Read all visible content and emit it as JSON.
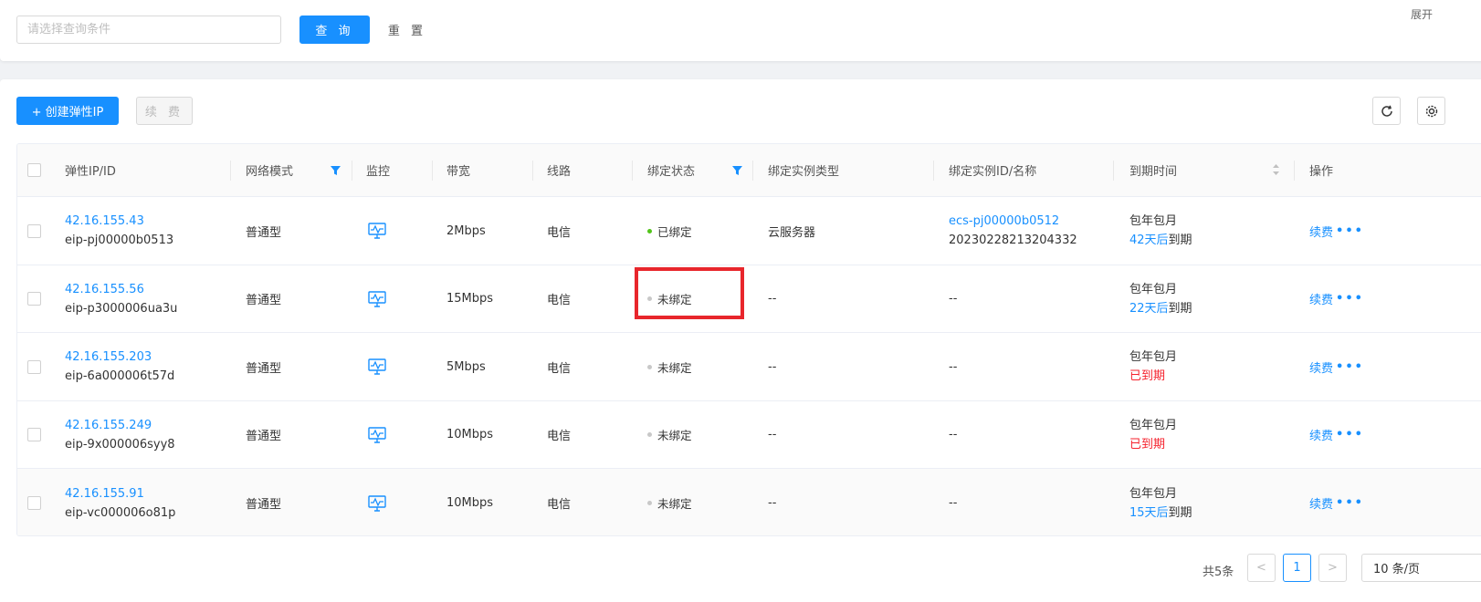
{
  "search": {
    "placeholder": "请选择查询条件",
    "query_label": "查 询",
    "reset_label": "重 置",
    "expand_label": "展开"
  },
  "toolbar": {
    "create_label": "+ 创建弹性IP",
    "renew_label": "续 费"
  },
  "table": {
    "headers": {
      "ip": "弹性IP/ID",
      "mode": "网络模式",
      "monitor": "监控",
      "bandwidth": "带宽",
      "line": "线路",
      "bind_status": "绑定状态",
      "instance_type": "绑定实例类型",
      "instance_id": "绑定实例ID/名称",
      "expire": "到期时间",
      "action": "操作"
    },
    "rows": [
      {
        "ip": "42.16.155.43",
        "id": "eip-pj00000b0513",
        "mode": "普通型",
        "bandwidth": "2Mbps",
        "line": "电信",
        "bind_status": "已绑定",
        "instance_type": "云服务器",
        "instance_id": "ecs-pj00000b0512",
        "instance_name": "20230228213204332",
        "billing": "包年包月",
        "expire_prefix": "42天后",
        "expire_suffix": "到期",
        "action": "续费"
      },
      {
        "ip": "42.16.155.56",
        "id": "eip-p3000006ua3u",
        "mode": "普通型",
        "bandwidth": "15Mbps",
        "line": "电信",
        "bind_status": "未绑定",
        "instance_type": "--",
        "instance_id": "--",
        "billing": "包年包月",
        "expire_prefix": "22天后",
        "expire_suffix": "到期",
        "action": "续费"
      },
      {
        "ip": "42.16.155.203",
        "id": "eip-6a000006t57d",
        "mode": "普通型",
        "bandwidth": "5Mbps",
        "line": "电信",
        "bind_status": "未绑定",
        "instance_type": "--",
        "instance_id": "--",
        "billing": "包年包月",
        "expired": "已到期",
        "action": "续费"
      },
      {
        "ip": "42.16.155.249",
        "id": "eip-9x000006syy8",
        "mode": "普通型",
        "bandwidth": "10Mbps",
        "line": "电信",
        "bind_status": "未绑定",
        "instance_type": "--",
        "instance_id": "--",
        "billing": "包年包月",
        "expired": "已到期",
        "action": "续费"
      },
      {
        "ip": "42.16.155.91",
        "id": "eip-vc000006o81p",
        "mode": "普通型",
        "bandwidth": "10Mbps",
        "line": "电信",
        "bind_status": "未绑定",
        "instance_type": "--",
        "instance_id": "--",
        "billing": "包年包月",
        "expire_prefix": "15天后",
        "expire_suffix": "到期",
        "action": "续费"
      }
    ]
  },
  "pagination": {
    "total": "共5条",
    "current_page": "1",
    "page_size": "10 条/页"
  },
  "colors": {
    "primary": "#1890ff",
    "bound": "#52c41a",
    "unbound": "#c8c8c8",
    "expired": "#f5222d",
    "highlight": "#e8262c"
  }
}
